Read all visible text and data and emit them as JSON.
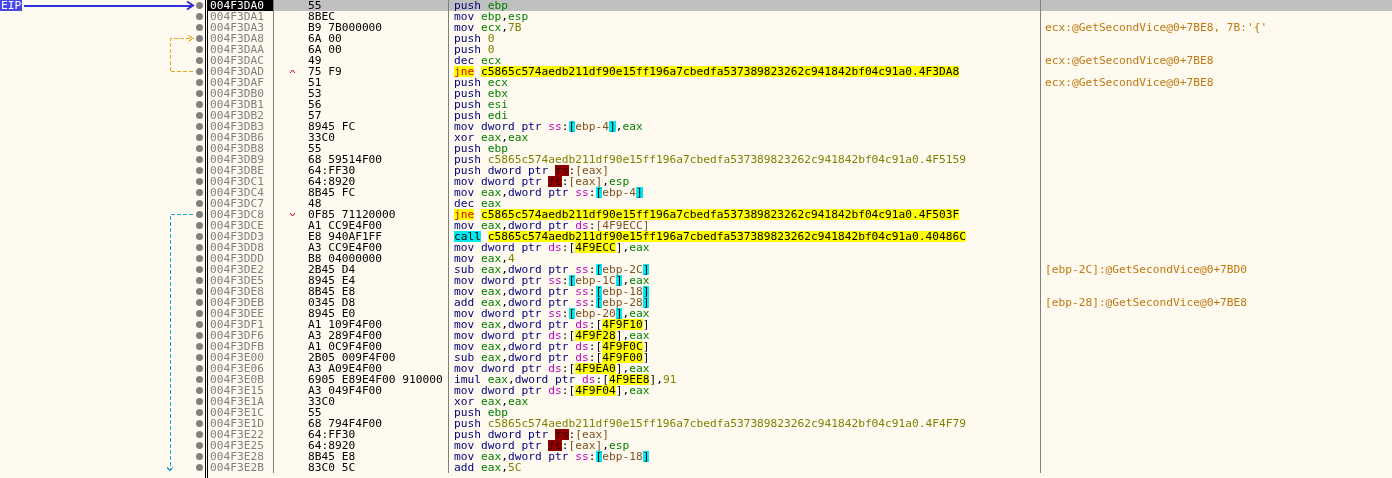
{
  "gutter": {
    "eip_label": "EIP"
  },
  "rows": [
    {
      "address": "004F3DA0",
      "bytes": "55",
      "mnemonic": "push",
      "kind": "plain",
      "current": true,
      "operands": [
        {
          "kind": "reg",
          "text": "ebp"
        }
      ]
    },
    {
      "address": "004F3DA1",
      "bytes": "8BEC",
      "mnemonic": "mov",
      "kind": "plain",
      "current": false,
      "operands": [
        {
          "kind": "reg",
          "text": "ebp"
        },
        {
          "kind": "p",
          "text": ","
        },
        {
          "kind": "reg",
          "text": "esp"
        }
      ]
    },
    {
      "address": "004F3DA3",
      "bytes": "B9 7B000000",
      "mnemonic": "mov",
      "kind": "plain",
      "current": false,
      "operands": [
        {
          "kind": "reg",
          "text": "ecx"
        },
        {
          "kind": "p",
          "text": ","
        },
        {
          "kind": "num",
          "text": "7B"
        }
      ],
      "comment": "ecx:@GetSecondVice@0+7BE8, 7B:'{'"
    },
    {
      "address": "004F3DA8",
      "bytes": "6A 00",
      "mnemonic": "push",
      "kind": "plain",
      "current": false,
      "jump_target": true,
      "operands": [
        {
          "kind": "num",
          "text": "0"
        }
      ]
    },
    {
      "address": "004F3DAA",
      "bytes": "6A 00",
      "mnemonic": "push",
      "kind": "plain",
      "current": false,
      "operands": [
        {
          "kind": "num",
          "text": "0"
        }
      ]
    },
    {
      "address": "004F3DAC",
      "bytes": "49",
      "mnemonic": "dec",
      "kind": "plain",
      "current": false,
      "operands": [
        {
          "kind": "reg",
          "text": "ecx"
        }
      ],
      "comment": "ecx:@GetSecondVice@0+7BE8"
    },
    {
      "address": "004F3DAD",
      "bytes": "75 F9",
      "mnemonic": "jne",
      "kind": "jump",
      "current": false,
      "jumps_back": true,
      "color": "#e8a820",
      "operands": [
        {
          "kind": "target",
          "text": "c5865c574aedb211df90e15ff196a7cbedfa537389823262c941842bf04c91a0.4F3DA8"
        }
      ]
    },
    {
      "address": "004F3DAF",
      "bytes": "51",
      "mnemonic": "push",
      "kind": "plain",
      "current": false,
      "operands": [
        {
          "kind": "reg",
          "text": "ecx"
        }
      ],
      "comment": "ecx:@GetSecondVice@0+7BE8"
    },
    {
      "address": "004F3DB0",
      "bytes": "53",
      "mnemonic": "push",
      "kind": "plain",
      "current": false,
      "operands": [
        {
          "kind": "reg",
          "text": "ebx"
        }
      ]
    },
    {
      "address": "004F3DB1",
      "bytes": "56",
      "mnemonic": "push",
      "kind": "plain",
      "current": false,
      "operands": [
        {
          "kind": "reg",
          "text": "esi"
        }
      ]
    },
    {
      "address": "004F3DB2",
      "bytes": "57",
      "mnemonic": "push",
      "kind": "plain",
      "current": false,
      "operands": [
        {
          "kind": "reg",
          "text": "edi"
        }
      ]
    },
    {
      "address": "004F3DB3",
      "bytes": "8945 FC",
      "mnemonic": "mov",
      "kind": "plain",
      "current": false,
      "operands": [
        {
          "kind": "size",
          "text": "dword ptr "
        },
        {
          "kind": "seg",
          "text": "ss"
        },
        {
          "kind": "p",
          "text": ":"
        },
        {
          "kind": "br",
          "text": "["
        },
        {
          "kind": "mem",
          "text": "ebp-4"
        },
        {
          "kind": "br",
          "text": "]"
        },
        {
          "kind": "p",
          "text": ","
        },
        {
          "kind": "reg",
          "text": "eax"
        }
      ]
    },
    {
      "address": "004F3DB6",
      "bytes": "33C0",
      "mnemonic": "xor",
      "kind": "plain",
      "current": false,
      "operands": [
        {
          "kind": "reg",
          "text": "eax"
        },
        {
          "kind": "p",
          "text": ","
        },
        {
          "kind": "reg",
          "text": "eax"
        }
      ]
    },
    {
      "address": "004F3DB8",
      "bytes": "55",
      "mnemonic": "push",
      "kind": "plain",
      "current": false,
      "operands": [
        {
          "kind": "reg",
          "text": "ebp"
        }
      ]
    },
    {
      "address": "004F3DB9",
      "bytes": "68 59514F00",
      "mnemonic": "push",
      "kind": "plain",
      "current": false,
      "operands": [
        {
          "kind": "sym",
          "text": "c5865c574aedb211df90e15ff196a7cbedfa537389823262c941842bf04c91a0.4F5159"
        }
      ]
    },
    {
      "address": "004F3DBE",
      "bytes": "64:FF30",
      "mnemonic": "push",
      "kind": "plain",
      "current": false,
      "operands": [
        {
          "kind": "size",
          "text": "dword ptr "
        },
        {
          "kind": "fs",
          "text": "fs"
        },
        {
          "kind": "p",
          "text": ":"
        },
        {
          "kind": "mem",
          "text": "[eax]"
        }
      ]
    },
    {
      "address": "004F3DC1",
      "bytes": "64:8920",
      "mnemonic": "mov",
      "kind": "plain",
      "current": false,
      "operands": [
        {
          "kind": "size",
          "text": "dword ptr "
        },
        {
          "kind": "fs",
          "text": "fs"
        },
        {
          "kind": "p",
          "text": ":"
        },
        {
          "kind": "mem",
          "text": "[eax]"
        },
        {
          "kind": "p",
          "text": ","
        },
        {
          "kind": "reg",
          "text": "esp"
        }
      ]
    },
    {
      "address": "004F3DC4",
      "bytes": "8B45 FC",
      "mnemonic": "mov",
      "kind": "plain",
      "current": false,
      "operands": [
        {
          "kind": "reg",
          "text": "eax"
        },
        {
          "kind": "p",
          "text": ","
        },
        {
          "kind": "size",
          "text": "dword ptr "
        },
        {
          "kind": "seg",
          "text": "ss"
        },
        {
          "kind": "p",
          "text": ":"
        },
        {
          "kind": "br",
          "text": "["
        },
        {
          "kind": "mem",
          "text": "ebp-4"
        },
        {
          "kind": "br",
          "text": "]"
        }
      ]
    },
    {
      "address": "004F3DC7",
      "bytes": "48",
      "mnemonic": "dec",
      "kind": "plain",
      "current": false,
      "operands": [
        {
          "kind": "reg",
          "text": "eax"
        }
      ]
    },
    {
      "address": "004F3DC8",
      "bytes": "0F85 71120000",
      "mnemonic": "jne",
      "kind": "jump",
      "current": false,
      "jumps_back": false,
      "color": "#20a8d0",
      "operands": [
        {
          "kind": "target",
          "text": "c5865c574aedb211df90e15ff196a7cbedfa537389823262c941842bf04c91a0.4F503F"
        }
      ]
    },
    {
      "address": "004F3DCE",
      "bytes": "A1 CC9E4F00",
      "mnemonic": "mov",
      "kind": "plain",
      "current": false,
      "operands": [
        {
          "kind": "reg",
          "text": "eax"
        },
        {
          "kind": "p",
          "text": ","
        },
        {
          "kind": "size",
          "text": "dword ptr "
        },
        {
          "kind": "seg",
          "text": "ds"
        },
        {
          "kind": "p",
          "text": ":"
        },
        {
          "kind": "mem",
          "text": "[4F9ECC]"
        }
      ]
    },
    {
      "address": "004F3DD3",
      "bytes": "E8 940AF1FF",
      "mnemonic": "call",
      "kind": "call",
      "current": false,
      "operands": [
        {
          "kind": "target",
          "text": "c5865c574aedb211df90e15ff196a7cbedfa537389823262c941842bf04c91a0.40486C"
        }
      ]
    },
    {
      "address": "004F3DD8",
      "bytes": "A3 CC9E4F00",
      "mnemonic": "mov",
      "kind": "plain",
      "current": false,
      "operands": [
        {
          "kind": "size",
          "text": "dword ptr "
        },
        {
          "kind": "seg",
          "text": "ds"
        },
        {
          "kind": "p",
          "text": ":["
        },
        {
          "kind": "addr",
          "text": "4F9ECC"
        },
        {
          "kind": "p",
          "text": "],"
        },
        {
          "kind": "reg",
          "text": "eax"
        }
      ]
    },
    {
      "address": "004F3DDD",
      "bytes": "B8 04000000",
      "mnemonic": "mov",
      "kind": "plain",
      "current": false,
      "operands": [
        {
          "kind": "reg",
          "text": "eax"
        },
        {
          "kind": "p",
          "text": ","
        },
        {
          "kind": "num",
          "text": "4"
        }
      ]
    },
    {
      "address": "004F3DE2",
      "bytes": "2B45 D4",
      "mnemonic": "sub",
      "kind": "plain",
      "current": false,
      "operands": [
        {
          "kind": "reg",
          "text": "eax"
        },
        {
          "kind": "p",
          "text": ","
        },
        {
          "kind": "size",
          "text": "dword ptr "
        },
        {
          "kind": "seg",
          "text": "ss"
        },
        {
          "kind": "p",
          "text": ":"
        },
        {
          "kind": "br",
          "text": "["
        },
        {
          "kind": "mem",
          "text": "ebp-2C"
        },
        {
          "kind": "br",
          "text": "]"
        }
      ],
      "comment": "[ebp-2C]:@GetSecondVice@0+7BD0"
    },
    {
      "address": "004F3DE5",
      "bytes": "8945 E4",
      "mnemonic": "mov",
      "kind": "plain",
      "current": false,
      "operands": [
        {
          "kind": "size",
          "text": "dword ptr "
        },
        {
          "kind": "seg",
          "text": "ss"
        },
        {
          "kind": "p",
          "text": ":"
        },
        {
          "kind": "br",
          "text": "["
        },
        {
          "kind": "mem",
          "text": "ebp-1C"
        },
        {
          "kind": "br",
          "text": "]"
        },
        {
          "kind": "p",
          "text": ","
        },
        {
          "kind": "reg",
          "text": "eax"
        }
      ]
    },
    {
      "address": "004F3DE8",
      "bytes": "8B45 E8",
      "mnemonic": "mov",
      "kind": "plain",
      "current": false,
      "operands": [
        {
          "kind": "reg",
          "text": "eax"
        },
        {
          "kind": "p",
          "text": ","
        },
        {
          "kind": "size",
          "text": "dword ptr "
        },
        {
          "kind": "seg",
          "text": "ss"
        },
        {
          "kind": "p",
          "text": ":"
        },
        {
          "kind": "br",
          "text": "["
        },
        {
          "kind": "mem",
          "text": "ebp-18"
        },
        {
          "kind": "br",
          "text": "]"
        }
      ]
    },
    {
      "address": "004F3DEB",
      "bytes": "0345 D8",
      "mnemonic": "add",
      "kind": "plain",
      "current": false,
      "operands": [
        {
          "kind": "reg",
          "text": "eax"
        },
        {
          "kind": "p",
          "text": ","
        },
        {
          "kind": "size",
          "text": "dword ptr "
        },
        {
          "kind": "seg",
          "text": "ss"
        },
        {
          "kind": "p",
          "text": ":"
        },
        {
          "kind": "br",
          "text": "["
        },
        {
          "kind": "mem",
          "text": "ebp-28"
        },
        {
          "kind": "br",
          "text": "]"
        }
      ],
      "comment": "[ebp-28]:@GetSecondVice@0+7BE8"
    },
    {
      "address": "004F3DEE",
      "bytes": "8945 E0",
      "mnemonic": "mov",
      "kind": "plain",
      "current": false,
      "operands": [
        {
          "kind": "size",
          "text": "dword ptr "
        },
        {
          "kind": "seg",
          "text": "ss"
        },
        {
          "kind": "p",
          "text": ":"
        },
        {
          "kind": "br",
          "text": "["
        },
        {
          "kind": "mem",
          "text": "ebp-20"
        },
        {
          "kind": "br",
          "text": "]"
        },
        {
          "kind": "p",
          "text": ","
        },
        {
          "kind": "reg",
          "text": "eax"
        }
      ]
    },
    {
      "address": "004F3DF1",
      "bytes": "A1 109F4F00",
      "mnemonic": "mov",
      "kind": "plain",
      "current": false,
      "operands": [
        {
          "kind": "reg",
          "text": "eax"
        },
        {
          "kind": "p",
          "text": ","
        },
        {
          "kind": "size",
          "text": "dword ptr "
        },
        {
          "kind": "seg",
          "text": "ds"
        },
        {
          "kind": "p",
          "text": ":["
        },
        {
          "kind": "addr",
          "text": "4F9F10"
        },
        {
          "kind": "p",
          "text": "]"
        }
      ]
    },
    {
      "address": "004F3DF6",
      "bytes": "A3 289F4F00",
      "mnemonic": "mov",
      "kind": "plain",
      "current": false,
      "operands": [
        {
          "kind": "size",
          "text": "dword ptr "
        },
        {
          "kind": "seg",
          "text": "ds"
        },
        {
          "kind": "p",
          "text": ":["
        },
        {
          "kind": "addr",
          "text": "4F9F28"
        },
        {
          "kind": "p",
          "text": "],"
        },
        {
          "kind": "reg",
          "text": "eax"
        }
      ]
    },
    {
      "address": "004F3DFB",
      "bytes": "A1 0C9F4F00",
      "mnemonic": "mov",
      "kind": "plain",
      "current": false,
      "operands": [
        {
          "kind": "reg",
          "text": "eax"
        },
        {
          "kind": "p",
          "text": ","
        },
        {
          "kind": "size",
          "text": "dword ptr "
        },
        {
          "kind": "seg",
          "text": "ds"
        },
        {
          "kind": "p",
          "text": ":["
        },
        {
          "kind": "addr",
          "text": "4F9F0C"
        },
        {
          "kind": "p",
          "text": "]"
        }
      ]
    },
    {
      "address": "004F3E00",
      "bytes": "2B05 009F4F00",
      "mnemonic": "sub",
      "kind": "plain",
      "current": false,
      "operands": [
        {
          "kind": "reg",
          "text": "eax"
        },
        {
          "kind": "p",
          "text": ","
        },
        {
          "kind": "size",
          "text": "dword ptr "
        },
        {
          "kind": "seg",
          "text": "ds"
        },
        {
          "kind": "p",
          "text": ":["
        },
        {
          "kind": "addr",
          "text": "4F9F00"
        },
        {
          "kind": "p",
          "text": "]"
        }
      ]
    },
    {
      "address": "004F3E06",
      "bytes": "A3 A09E4F00",
      "mnemonic": "mov",
      "kind": "plain",
      "current": false,
      "operands": [
        {
          "kind": "size",
          "text": "dword ptr "
        },
        {
          "kind": "seg",
          "text": "ds"
        },
        {
          "kind": "p",
          "text": ":["
        },
        {
          "kind": "addr",
          "text": "4F9EA0"
        },
        {
          "kind": "p",
          "text": "],"
        },
        {
          "kind": "reg",
          "text": "eax"
        }
      ]
    },
    {
      "address": "004F3E0B",
      "bytes": "6905 E89E4F00 910000",
      "mnemonic": "imul",
      "kind": "plain",
      "current": false,
      "operands": [
        {
          "kind": "reg",
          "text": "eax"
        },
        {
          "kind": "p",
          "text": ","
        },
        {
          "kind": "size",
          "text": "dword ptr "
        },
        {
          "kind": "seg",
          "text": "ds"
        },
        {
          "kind": "p",
          "text": ":["
        },
        {
          "kind": "addr",
          "text": "4F9EE8"
        },
        {
          "kind": "p",
          "text": "],"
        },
        {
          "kind": "num",
          "text": "91"
        }
      ]
    },
    {
      "address": "004F3E15",
      "bytes": "A3 049F4F00",
      "mnemonic": "mov",
      "kind": "plain",
      "current": false,
      "operands": [
        {
          "kind": "size",
          "text": "dword ptr "
        },
        {
          "kind": "seg",
          "text": "ds"
        },
        {
          "kind": "p",
          "text": ":["
        },
        {
          "kind": "addr",
          "text": "4F9F04"
        },
        {
          "kind": "p",
          "text": "],"
        },
        {
          "kind": "reg",
          "text": "eax"
        }
      ]
    },
    {
      "address": "004F3E1A",
      "bytes": "33C0",
      "mnemonic": "xor",
      "kind": "plain",
      "current": false,
      "operands": [
        {
          "kind": "reg",
          "text": "eax"
        },
        {
          "kind": "p",
          "text": ","
        },
        {
          "kind": "reg",
          "text": "eax"
        }
      ]
    },
    {
      "address": "004F3E1C",
      "bytes": "55",
      "mnemonic": "push",
      "kind": "plain",
      "current": false,
      "operands": [
        {
          "kind": "reg",
          "text": "ebp"
        }
      ]
    },
    {
      "address": "004F3E1D",
      "bytes": "68 794F4F00",
      "mnemonic": "push",
      "kind": "plain",
      "current": false,
      "operands": [
        {
          "kind": "sym",
          "text": "c5865c574aedb211df90e15ff196a7cbedfa537389823262c941842bf04c91a0.4F4F79"
        }
      ]
    },
    {
      "address": "004F3E22",
      "bytes": "64:FF30",
      "mnemonic": "push",
      "kind": "plain",
      "current": false,
      "operands": [
        {
          "kind": "size",
          "text": "dword ptr "
        },
        {
          "kind": "fs",
          "text": "fs"
        },
        {
          "kind": "p",
          "text": ":"
        },
        {
          "kind": "mem",
          "text": "[eax]"
        }
      ]
    },
    {
      "address": "004F3E25",
      "bytes": "64:8920",
      "mnemonic": "mov",
      "kind": "plain",
      "current": false,
      "operands": [
        {
          "kind": "size",
          "text": "dword ptr "
        },
        {
          "kind": "fs",
          "text": "fs"
        },
        {
          "kind": "p",
          "text": ":"
        },
        {
          "kind": "mem",
          "text": "[eax]"
        },
        {
          "kind": "p",
          "text": ","
        },
        {
          "kind": "reg",
          "text": "esp"
        }
      ]
    },
    {
      "address": "004F3E28",
      "bytes": "8B45 E8",
      "mnemonic": "mov",
      "kind": "plain",
      "current": false,
      "operands": [
        {
          "kind": "reg",
          "text": "eax"
        },
        {
          "kind": "p",
          "text": ","
        },
        {
          "kind": "size",
          "text": "dword ptr "
        },
        {
          "kind": "seg",
          "text": "ss"
        },
        {
          "kind": "p",
          "text": ":"
        },
        {
          "kind": "br",
          "text": "["
        },
        {
          "kind": "mem",
          "text": "ebp-18"
        },
        {
          "kind": "br",
          "text": "]"
        }
      ]
    },
    {
      "address": "004F3E2B",
      "bytes": "83C0 5C",
      "mnemonic": "add",
      "kind": "plain",
      "current": false,
      "operands": [
        {
          "kind": "reg",
          "text": "eax"
        },
        {
          "kind": "p",
          "text": ","
        },
        {
          "kind": "num",
          "text": "5C"
        }
      ]
    }
  ]
}
